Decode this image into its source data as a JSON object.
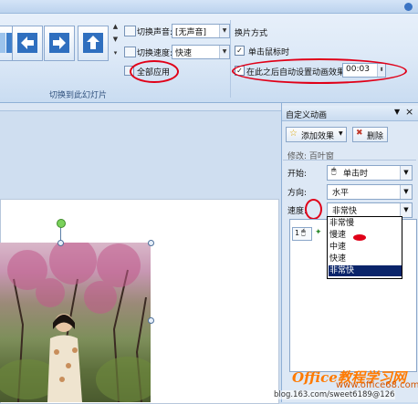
{
  "ribbon": {
    "sound_label": "切换声音:",
    "sound_value": "[无声音]",
    "speed_label": "切换速度:",
    "speed_value": "快速",
    "apply_all": "全部应用",
    "group_label": "切换到此幻灯片",
    "advance_title": "换片方式",
    "on_click_label": "单击鼠标时",
    "after_label": "在此之后自动设置动画效果:",
    "after_value": "00:03"
  },
  "pane": {
    "title": "自定义动画",
    "close_glyph": "×",
    "add_effect": "添加效果",
    "delete": "删除",
    "modify": "修改: 百叶窗",
    "start_label": "开始:",
    "start_value": "单击时",
    "direction_label": "方向:",
    "direction_value": "水平",
    "speed_label": "速度:",
    "speed_value": "非常快",
    "list_item_index": "1",
    "speed_options": [
      "非常慢",
      "慢速",
      "中速",
      "快速",
      "非常快"
    ],
    "selected_speed": "非常快"
  },
  "watermark": {
    "site": "Office教程学习网",
    "url": "www.office68.com",
    "blog": "blog.163.com/sweet6189@126"
  },
  "colors": {
    "annotation_red": "#e00018",
    "selected_item_bg": "#0a246a",
    "watermark_orange": "#ff7a00"
  }
}
